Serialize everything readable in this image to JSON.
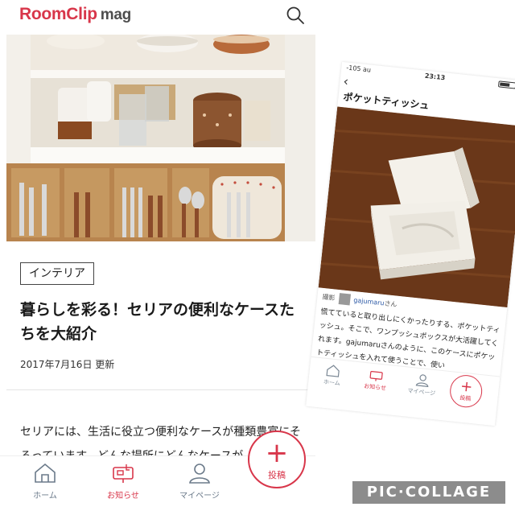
{
  "app": {
    "logo_main": "RoomClip",
    "logo_sub": "mag"
  },
  "article": {
    "category_tag": "インテリア",
    "title": "暮らしを彩る！セリアの便利なケースたちを大紹介",
    "date": "2017年7月16日 更新",
    "body": "セリアには、生活に役立つ便利なケースが種類豊富にそろっています。どんな場所にどんなケースが"
  },
  "bottom_nav": {
    "home": "ホーム",
    "notifications": "お知らせ",
    "mypage": "マイページ",
    "post": "投稿",
    "post_symbol": "+"
  },
  "screenshot": {
    "status_carrier": "-105 au",
    "status_time": "23:13",
    "back_symbol": "‹",
    "title": "ポケットティッシュ",
    "credit_prefix": "撮影",
    "credit_user": "gajumaru",
    "credit_suffix": "さん",
    "body": "慌てていると取り出しにくかったりする、ポケットティッシュ。そこで、ワンプッシュボックスが大活躍してくれます。gajumaruさんのように、このケースにポケットティッシュを入れて使うことで、使い",
    "nav_home": "ホーム",
    "nav_notifications": "お知らせ",
    "nav_mypage": "マイページ",
    "nav_post": "投稿",
    "nav_post_symbol": "+"
  },
  "watermark": "PIC·COLLAGE",
  "colors": {
    "accent": "#d8364a",
    "nav_gray": "#6b7a8a"
  }
}
